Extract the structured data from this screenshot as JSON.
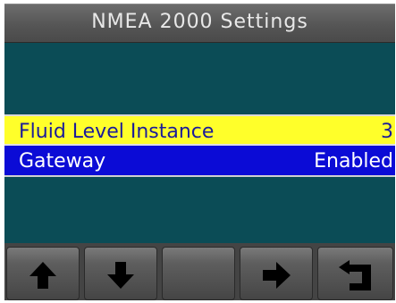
{
  "header": {
    "title": "NMEA 2000 Settings"
  },
  "menu": {
    "items": [
      {
        "label": "Fluid Level Instance",
        "value": "3",
        "selected": true
      },
      {
        "label": "Gateway",
        "value": "Enabled",
        "selected": false
      }
    ]
  },
  "softkeys": [
    {
      "icon": "arrow-up-icon"
    },
    {
      "icon": "arrow-down-icon"
    },
    {
      "icon": ""
    },
    {
      "icon": "arrow-right-icon"
    },
    {
      "icon": "return-icon"
    }
  ],
  "colors": {
    "background": "#0b4c56",
    "selected_row": "#ffff2a",
    "normal_row": "#0b0bd6",
    "title_bar": "#5a5a5a"
  }
}
